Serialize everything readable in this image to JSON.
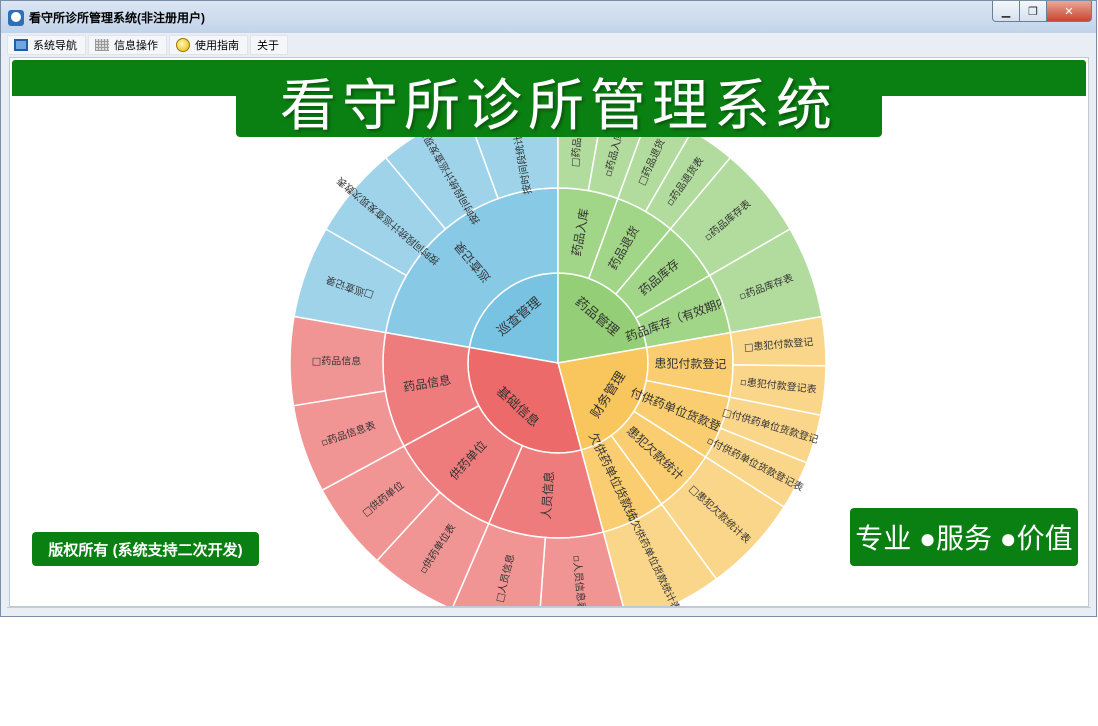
{
  "window": {
    "title": "看守所诊所管理系统(非注册用户)",
    "controls": {
      "minimize": "▁",
      "maximize": "❐",
      "close": "✕"
    }
  },
  "menu": [
    {
      "label": "系统导航",
      "icon": "monitor-icon"
    },
    {
      "label": "信息操作",
      "icon": "grid-icon"
    },
    {
      "label": "使用指南",
      "icon": "help-icon"
    },
    {
      "label": "关于",
      "icon": ""
    }
  ],
  "banner": {
    "title": "看守所诊所管理系统"
  },
  "footer": {
    "copyright": "版权所有 (系统支持二次开发)",
    "slogan": "专业 ●服务 ●价值"
  },
  "colors": {
    "brand_green": "#0b8012",
    "blue": "#79c1e1",
    "green": "#93cf78",
    "orange": "#f8c55c",
    "red": "#ec6b6b"
  },
  "chart_data": {
    "type": "sunburst",
    "sectors": [
      {
        "name": "巡查管理",
        "color": "#78c2e2",
        "children": [
          {
            "name": "巡查记录",
            "children": [
              {
                "name": "□巡查记录",
                "children": []
              },
              {
                "name": "按时间段统计巡查发现次数表",
                "children": [
                  {
                    "name": "▫按时间段统计巡查发现次数表",
                    "children": []
                  }
                ]
              },
              {
                "name": "按时间段统计巡查发现次数",
                "children": [
                  {
                    "name": "▫按时间段统计巡查发现次数表",
                    "children": []
                  }
                ]
              },
              {
                "name": "按时间段统计患犯情况",
                "children": [
                  {
                    "name": "▫按时间段统计患犯情况表",
                    "children": []
                  }
                ]
              }
            ]
          }
        ]
      },
      {
        "name": "药品管理",
        "color": "#94cf77",
        "children": [
          {
            "name": "药品入库",
            "children": [
              {
                "name": "□药品入库",
                "children": []
              },
              {
                "name": "▫药品入库表",
                "children": []
              }
            ]
          },
          {
            "name": "药品退货",
            "children": [
              {
                "name": "□药品退货",
                "children": []
              },
              {
                "name": "▫药品退货表",
                "children": []
              }
            ]
          },
          {
            "name": "药品库存",
            "children": [
              {
                "name": "▫药品库存表",
                "children": []
              }
            ]
          },
          {
            "name": "药品库存（有效期内）",
            "children": [
              {
                "name": "▫药品库存表",
                "children": []
              }
            ]
          }
        ]
      },
      {
        "name": "财务管理",
        "color": "#f8c65d",
        "children": [
          {
            "name": "患犯付款登记",
            "children": [
              {
                "name": "□患犯付款登记",
                "children": []
              },
              {
                "name": "▫患犯付款登记表",
                "children": []
              }
            ]
          },
          {
            "name": "付供药单位货款登记",
            "children": [
              {
                "name": "□付供药单位货款登记",
                "children": []
              },
              {
                "name": "▫付供药单位货款登记表",
                "children": []
              }
            ]
          },
          {
            "name": "患犯欠款统计",
            "children": [
              {
                "name": "□患犯欠款统计表",
                "children": []
              }
            ]
          },
          {
            "name": "欠供药单位货款统计",
            "children": [
              {
                "name": "▫欠供药单位货款统计表",
                "children": []
              }
            ]
          }
        ]
      },
      {
        "name": "基础信息",
        "color": "#ec6a6a",
        "children": [
          {
            "name": "人员信息",
            "children": [
              {
                "name": "▫人员信息表",
                "children": []
              },
              {
                "name": "□人员信息",
                "children": []
              }
            ]
          },
          {
            "name": "供药单位",
            "children": [
              {
                "name": "▫供药单位表",
                "children": []
              },
              {
                "name": "□供药单位",
                "children": []
              }
            ]
          },
          {
            "name": "药品信息",
            "children": [
              {
                "name": "▫药品信息表",
                "children": []
              },
              {
                "name": "□药品信息",
                "children": []
              }
            ]
          }
        ]
      }
    ]
  }
}
